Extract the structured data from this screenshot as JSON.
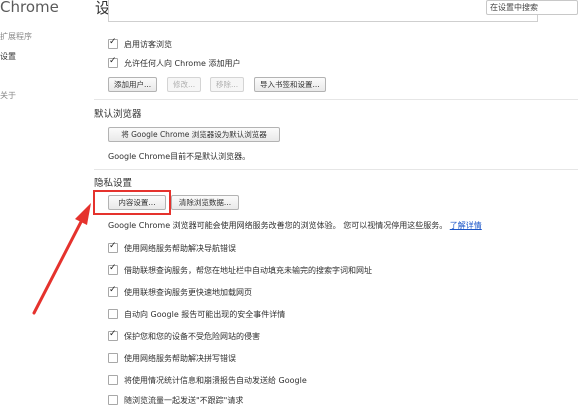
{
  "sidebar": {
    "app_title": "Chrome",
    "items": [
      {
        "label": "扩展程序"
      },
      {
        "label": "设置"
      },
      {
        "label": "关于"
      }
    ]
  },
  "header": {
    "title": "设置",
    "search_placeholder": "在设置中搜索"
  },
  "users": {
    "options": [
      {
        "label": "启用访客浏览",
        "checked": true
      },
      {
        "label": "允许任何人向 Chrome 添加用户",
        "checked": true
      }
    ],
    "buttons": {
      "add": "添加用户...",
      "edit": "修改...",
      "remove": "移除...",
      "import": "导入书签和设置..."
    }
  },
  "default_browser": {
    "title": "默认浏览器",
    "button": "将 Google Chrome 浏览器设为默认浏览器",
    "status": "Google Chrome目前不是默认浏览器。"
  },
  "privacy": {
    "title": "隐私设置",
    "content_settings_button": "内容设置...",
    "clear_data_button": "清除浏览数据...",
    "description": "Google Chrome 浏览器可能会使用网络服务改善您的浏览体验。 您可以视情况停用这些服务。",
    "learn_more": "了解详情",
    "options": [
      {
        "label": "使用网络服务帮助解决导航错误",
        "checked": true
      },
      {
        "label": "借助联想查询服务，帮您在地址栏中自动填充未输完的搜索字词和网址",
        "checked": true
      },
      {
        "label": "使用联想查询服务更快速地加载网页",
        "checked": true
      },
      {
        "label": "自动向 Google 报告可能出现的安全事件详情",
        "checked": false
      },
      {
        "label": "保护您和您的设备不受危险网站的侵害",
        "checked": true
      },
      {
        "label": "使用网络服务帮助解决拼写错误",
        "checked": false
      },
      {
        "label": "将使用情况统计信息和崩溃报告自动发送给 Google",
        "checked": false
      },
      {
        "label": "随浏览流量一起发送\"不跟踪\"请求",
        "checked": false
      }
    ]
  },
  "annotation": {
    "color": "#e5322d"
  }
}
